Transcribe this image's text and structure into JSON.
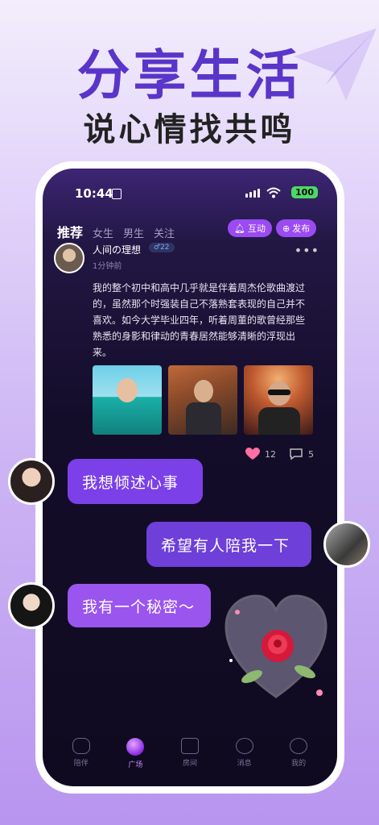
{
  "banner": {
    "title": "分享生活",
    "subtitle": "说心情找共鸣"
  },
  "status_bar": {
    "time": "10:44",
    "battery": "100"
  },
  "tabs": [
    {
      "label": "推荐",
      "active": true
    },
    {
      "label": "女生",
      "active": false
    },
    {
      "label": "男生",
      "active": false
    },
    {
      "label": "关注",
      "active": false
    }
  ],
  "actions": {
    "interact_label": "互动",
    "publish_label": "发布"
  },
  "post": {
    "author": "人间の理想",
    "badge": "♂22",
    "time": "1分钟前",
    "content": "我的整个初中和高中几乎就是伴着周杰伦歌曲渡过的，虽然那个时强装自己不落熟套表现的自己并不喜欢。如今大学毕业四年，听着周董的歌曾经那些熟悉的身影和律动的青春居然能够清晰的浮现出来。",
    "likes": "12",
    "comments": "5"
  },
  "bubbles": [
    {
      "text": "我想倾述心事"
    },
    {
      "text": "希望有人陪我一下"
    },
    {
      "text": "我有一个秘密～"
    }
  ],
  "bottom_nav": [
    {
      "label": "陪伴",
      "active": false
    },
    {
      "label": "广场",
      "active": true
    },
    {
      "label": "房间",
      "active": false
    },
    {
      "label": "消息",
      "active": false
    },
    {
      "label": "我的",
      "active": false
    }
  ],
  "colors": {
    "accent": "#9b4bf2",
    "headline": "#5a35c9",
    "bubble_dark": "#7b40e8",
    "bubble_light": "#9a55ee"
  }
}
